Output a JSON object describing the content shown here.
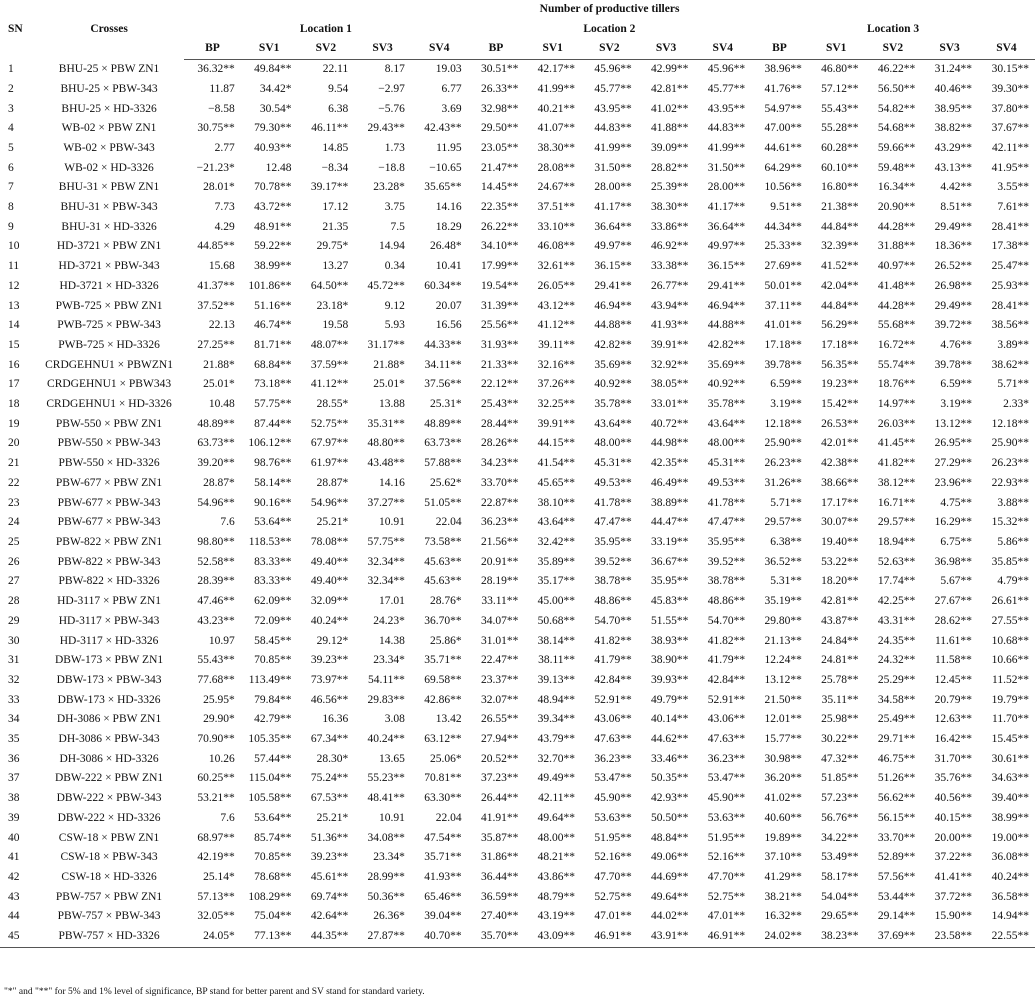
{
  "header": {
    "sn": "SN",
    "crosses": "Crosses",
    "main_title": "Number of productive tillers",
    "locations": [
      "Location 1",
      "Location 2",
      "Location 3"
    ],
    "subcols": [
      "BP",
      "SV1",
      "SV2",
      "SV3",
      "SV4"
    ]
  },
  "rows": [
    {
      "sn": "1",
      "cross": "BHU-25 × PBW ZN1",
      "v": [
        "36.32**",
        "49.84**",
        "22.11",
        "8.17",
        "19.03",
        "30.51**",
        "42.17**",
        "45.96**",
        "42.99**",
        "45.96**",
        "38.96**",
        "46.80**",
        "46.22**",
        "31.24**",
        "30.15**"
      ]
    },
    {
      "sn": "2",
      "cross": "BHU-25 × PBW-343",
      "v": [
        "11.87",
        "34.42*",
        "9.54",
        "−2.97",
        "6.77",
        "26.33**",
        "41.99**",
        "45.77**",
        "42.81**",
        "45.77**",
        "41.76**",
        "57.12**",
        "56.50**",
        "40.46**",
        "39.30**"
      ]
    },
    {
      "sn": "3",
      "cross": "BHU-25 × HD-3326",
      "v": [
        "−8.58",
        "30.54*",
        "6.38",
        "−5.76",
        "3.69",
        "32.98**",
        "40.21**",
        "43.95**",
        "41.02**",
        "43.95**",
        "54.97**",
        "55.43**",
        "54.82**",
        "38.95**",
        "37.80**"
      ]
    },
    {
      "sn": "4",
      "cross": "WB-02 × PBW ZN1",
      "v": [
        "30.75**",
        "79.30**",
        "46.11**",
        "29.43**",
        "42.43**",
        "29.50**",
        "41.07**",
        "44.83**",
        "41.88**",
        "44.83**",
        "47.00**",
        "55.28**",
        "54.68**",
        "38.82**",
        "37.67**"
      ]
    },
    {
      "sn": "5",
      "cross": "WB-02 × PBW-343",
      "v": [
        "2.77",
        "40.93**",
        "14.85",
        "1.73",
        "11.95",
        "23.05**",
        "38.30**",
        "41.99**",
        "39.09**",
        "41.99**",
        "44.61**",
        "60.28**",
        "59.66**",
        "43.29**",
        "42.11**"
      ]
    },
    {
      "sn": "6",
      "cross": "WB-02 × HD-3326",
      "v": [
        "−21.23*",
        "12.48",
        "−8.34",
        "−18.8",
        "−10.65",
        "21.47**",
        "28.08**",
        "31.50**",
        "28.82**",
        "31.50**",
        "64.29**",
        "60.10**",
        "59.48**",
        "43.13**",
        "41.95**"
      ]
    },
    {
      "sn": "7",
      "cross": "BHU-31 × PBW ZN1",
      "v": [
        "28.01*",
        "70.78**",
        "39.17**",
        "23.28*",
        "35.65**",
        "14.45**",
        "24.67**",
        "28.00**",
        "25.39**",
        "28.00**",
        "10.56**",
        "16.80**",
        "16.34**",
        "4.42**",
        "3.55**"
      ]
    },
    {
      "sn": "8",
      "cross": "BHU-31 × PBW-343",
      "v": [
        "7.73",
        "43.72**",
        "17.12",
        "3.75",
        "14.16",
        "22.35**",
        "37.51**",
        "41.17**",
        "38.30**",
        "41.17**",
        "9.51**",
        "21.38**",
        "20.90**",
        "8.51**",
        "7.61**"
      ]
    },
    {
      "sn": "9",
      "cross": "BHU-31 × HD-3326",
      "v": [
        "4.29",
        "48.91**",
        "21.35",
        "7.5",
        "18.29",
        "26.22**",
        "33.10**",
        "36.64**",
        "33.86**",
        "36.64**",
        "44.34**",
        "44.84**",
        "44.28**",
        "29.49**",
        "28.41**"
      ]
    },
    {
      "sn": "10",
      "cross": "HD-3721 × PBW ZN1",
      "v": [
        "44.85**",
        "59.22**",
        "29.75*",
        "14.94",
        "26.48*",
        "34.10**",
        "46.08**",
        "49.97**",
        "46.92**",
        "49.97**",
        "25.33**",
        "32.39**",
        "31.88**",
        "18.36**",
        "17.38**"
      ]
    },
    {
      "sn": "11",
      "cross": "HD-3721 × PBW-343",
      "v": [
        "15.68",
        "38.99**",
        "13.27",
        "0.34",
        "10.41",
        "17.99**",
        "32.61**",
        "36.15**",
        "33.38**",
        "36.15**",
        "27.69**",
        "41.52**",
        "40.97**",
        "26.52**",
        "25.47**"
      ]
    },
    {
      "sn": "12",
      "cross": "HD-3721 × HD-3326",
      "v": [
        "41.37**",
        "101.86**",
        "64.50**",
        "45.72**",
        "60.34**",
        "19.54**",
        "26.05**",
        "29.41**",
        "26.77**",
        "29.41**",
        "50.01**",
        "42.04**",
        "41.48**",
        "26.98**",
        "25.93**"
      ]
    },
    {
      "sn": "13",
      "cross": "PWB-725 × PBW ZN1",
      "v": [
        "37.52**",
        "51.16**",
        "23.18*",
        "9.12",
        "20.07",
        "31.39**",
        "43.12**",
        "46.94**",
        "43.94**",
        "46.94**",
        "37.11**",
        "44.84**",
        "44.28**",
        "29.49**",
        "28.41**"
      ]
    },
    {
      "sn": "14",
      "cross": "PWB-725 × PBW-343",
      "v": [
        "22.13",
        "46.74**",
        "19.58",
        "5.93",
        "16.56",
        "25.56**",
        "41.12**",
        "44.88**",
        "41.93**",
        "44.88**",
        "41.01**",
        "56.29**",
        "55.68**",
        "39.72**",
        "38.56**"
      ]
    },
    {
      "sn": "15",
      "cross": "PWB-725 × HD-3326",
      "v": [
        "27.25**",
        "81.71**",
        "48.07**",
        "31.17**",
        "44.33**",
        "31.93**",
        "39.11**",
        "42.82**",
        "39.91**",
        "42.82**",
        "17.18**",
        "17.18**",
        "16.72**",
        "4.76**",
        "3.89**"
      ]
    },
    {
      "sn": "16",
      "cross": "CRDGEHNU1 × PBWZN1",
      "v": [
        "21.88*",
        "68.84**",
        "37.59**",
        "21.88*",
        "34.11**",
        "21.33**",
        "32.16**",
        "35.69**",
        "32.92**",
        "35.69**",
        "39.78**",
        "56.35**",
        "55.74**",
        "39.78**",
        "38.62**"
      ]
    },
    {
      "sn": "17",
      "cross": "CRDGEHNU1 × PBW343",
      "v": [
        "25.01*",
        "73.18**",
        "41.12**",
        "25.01*",
        "37.56**",
        "22.12**",
        "37.26**",
        "40.92**",
        "38.05**",
        "40.92**",
        "6.59**",
        "19.23**",
        "18.76**",
        "6.59**",
        "5.71**"
      ]
    },
    {
      "sn": "18",
      "cross": "CRDGEHNU1 × HD-3326",
      "v": [
        "10.48",
        "57.75**",
        "28.55*",
        "13.88",
        "25.31*",
        "25.43**",
        "32.25**",
        "35.78**",
        "33.01**",
        "35.78**",
        "3.19**",
        "15.42**",
        "14.97**",
        "3.19**",
        "2.33*"
      ]
    },
    {
      "sn": "19",
      "cross": "PBW-550 × PBW ZN1",
      "v": [
        "48.89**",
        "87.44**",
        "52.75**",
        "35.31**",
        "48.89**",
        "28.44**",
        "39.91**",
        "43.64**",
        "40.72**",
        "43.64**",
        "12.18**",
        "26.53**",
        "26.03**",
        "13.12**",
        "12.18**"
      ]
    },
    {
      "sn": "20",
      "cross": "PBW-550 × PBW-343",
      "v": [
        "63.73**",
        "106.12**",
        "67.97**",
        "48.80**",
        "63.73**",
        "28.26**",
        "44.15**",
        "48.00**",
        "44.98**",
        "48.00**",
        "25.90**",
        "42.01**",
        "41.45**",
        "26.95**",
        "25.90**"
      ]
    },
    {
      "sn": "21",
      "cross": "PBW-550 × HD-3326",
      "v": [
        "39.20**",
        "98.76**",
        "61.97**",
        "43.48**",
        "57.88**",
        "34.23**",
        "41.54**",
        "45.31**",
        "42.35**",
        "45.31**",
        "26.23**",
        "42.38**",
        "41.82**",
        "27.29**",
        "26.23**"
      ]
    },
    {
      "sn": "22",
      "cross": "PBW-677 × PBW ZN1",
      "v": [
        "28.87*",
        "58.14**",
        "28.87*",
        "14.16",
        "25.62*",
        "33.70**",
        "45.65**",
        "49.53**",
        "46.49**",
        "49.53**",
        "31.26**",
        "38.66**",
        "38.12**",
        "23.96**",
        "22.93**"
      ]
    },
    {
      "sn": "23",
      "cross": "PBW-677 × PBW-343",
      "v": [
        "54.96**",
        "90.16**",
        "54.96**",
        "37.27**",
        "51.05**",
        "22.87**",
        "38.10**",
        "41.78**",
        "38.89**",
        "41.78**",
        "5.71**",
        "17.17**",
        "16.71**",
        "4.75**",
        "3.88**"
      ]
    },
    {
      "sn": "24",
      "cross": "PBW-677 × PBW-343",
      "v": [
        "7.6",
        "53.64**",
        "25.21*",
        "10.91",
        "22.04",
        "36.23**",
        "43.64**",
        "47.47**",
        "44.47**",
        "47.47**",
        "29.57**",
        "30.07**",
        "29.57**",
        "16.29**",
        "15.32**"
      ]
    },
    {
      "sn": "25",
      "cross": "PBW-822 × PBW ZN1",
      "v": [
        "98.80**",
        "118.53**",
        "78.08**",
        "57.75**",
        "73.58**",
        "21.56**",
        "32.42**",
        "35.95**",
        "33.19**",
        "35.95**",
        "6.38**",
        "19.40**",
        "18.94**",
        "6.75**",
        "5.86**"
      ]
    },
    {
      "sn": "26",
      "cross": "PBW-822 × PBW-343",
      "v": [
        "52.58**",
        "83.33**",
        "49.40**",
        "32.34**",
        "45.63**",
        "20.91**",
        "35.89**",
        "39.52**",
        "36.67**",
        "39.52**",
        "36.52**",
        "53.22**",
        "52.63**",
        "36.98**",
        "35.85**"
      ]
    },
    {
      "sn": "27",
      "cross": "PBW-822 × HD-3326",
      "v": [
        "28.39**",
        "83.33**",
        "49.40**",
        "32.34**",
        "45.63**",
        "28.19**",
        "35.17**",
        "38.78**",
        "35.95**",
        "38.78**",
        "5.31**",
        "18.20**",
        "17.74**",
        "5.67**",
        "4.79**"
      ]
    },
    {
      "sn": "28",
      "cross": "HD-3117 × PBW ZN1",
      "v": [
        "47.46**",
        "62.09**",
        "32.09**",
        "17.01",
        "28.76*",
        "33.11**",
        "45.00**",
        "48.86**",
        "45.83**",
        "48.86**",
        "35.19**",
        "42.81**",
        "42.25**",
        "27.67**",
        "26.61**"
      ]
    },
    {
      "sn": "29",
      "cross": "HD-3117 × PBW-343",
      "v": [
        "43.23**",
        "72.09**",
        "40.24**",
        "24.23*",
        "36.70**",
        "34.07**",
        "50.68**",
        "54.70**",
        "51.55**",
        "54.70**",
        "29.80**",
        "43.87**",
        "43.31**",
        "28.62**",
        "27.55**"
      ]
    },
    {
      "sn": "30",
      "cross": "HD-3117 × HD-3326",
      "v": [
        "10.97",
        "58.45**",
        "29.12*",
        "14.38",
        "25.86*",
        "31.01**",
        "38.14**",
        "41.82**",
        "38.93**",
        "41.82**",
        "21.13**",
        "24.84**",
        "24.35**",
        "11.61**",
        "10.68**"
      ]
    },
    {
      "sn": "31",
      "cross": "DBW-173 × PBW ZN1",
      "v": [
        "55.43**",
        "70.85**",
        "39.23**",
        "23.34*",
        "35.71**",
        "22.47**",
        "38.11**",
        "41.79**",
        "38.90**",
        "41.79**",
        "12.24**",
        "24.81**",
        "24.32**",
        "11.58**",
        "10.66**"
      ]
    },
    {
      "sn": "32",
      "cross": "DBW-173 × PBW-343",
      "v": [
        "77.68**",
        "113.49**",
        "73.97**",
        "54.11**",
        "69.58**",
        "23.37**",
        "39.13**",
        "42.84**",
        "39.93**",
        "42.84**",
        "13.12**",
        "25.78**",
        "25.29**",
        "12.45**",
        "11.52**"
      ]
    },
    {
      "sn": "33",
      "cross": "DBW-173 × HD-3326",
      "v": [
        "25.95*",
        "79.84**",
        "46.56**",
        "29.83**",
        "42.86**",
        "32.07**",
        "48.94**",
        "52.91**",
        "49.79**",
        "52.91**",
        "21.50**",
        "35.11**",
        "34.58**",
        "20.79**",
        "19.79**"
      ]
    },
    {
      "sn": "34",
      "cross": "DH-3086 × PBW ZN1",
      "v": [
        "29.90*",
        "42.79**",
        "16.36",
        "3.08",
        "13.42",
        "26.55**",
        "39.34**",
        "43.06**",
        "40.14**",
        "43.06**",
        "12.01**",
        "25.98**",
        "25.49**",
        "12.63**",
        "11.70**"
      ]
    },
    {
      "sn": "35",
      "cross": "DH-3086 × PBW-343",
      "v": [
        "70.90**",
        "105.35**",
        "67.34**",
        "40.24**",
        "63.12**",
        "27.94**",
        "43.79**",
        "47.63**",
        "44.62**",
        "47.63**",
        "15.77**",
        "30.22**",
        "29.71**",
        "16.42**",
        "15.45**"
      ]
    },
    {
      "sn": "36",
      "cross": "DH-3086 × HD-3326",
      "v": [
        "10.26",
        "57.44**",
        "28.30*",
        "13.65",
        "25.06*",
        "20.52**",
        "32.70**",
        "36.23**",
        "33.46**",
        "36.23**",
        "30.98**",
        "47.32**",
        "46.75**",
        "31.70**",
        "30.61**"
      ]
    },
    {
      "sn": "37",
      "cross": "DBW-222 × PBW ZN1",
      "v": [
        "60.25**",
        "115.04**",
        "75.24**",
        "55.23**",
        "70.81**",
        "37.23**",
        "49.49**",
        "53.47**",
        "50.35**",
        "53.47**",
        "36.20**",
        "51.85**",
        "51.26**",
        "35.76**",
        "34.63**"
      ]
    },
    {
      "sn": "38",
      "cross": "DBW-222 × PBW-343",
      "v": [
        "53.21**",
        "105.58**",
        "67.53**",
        "48.41**",
        "63.30**",
        "26.44**",
        "42.11**",
        "45.90**",
        "42.93**",
        "45.90**",
        "41.02**",
        "57.23**",
        "56.62**",
        "40.56**",
        "39.40**"
      ]
    },
    {
      "sn": "39",
      "cross": "DBW-222 × HD-3326",
      "v": [
        "7.6",
        "53.64**",
        "25.21*",
        "10.91",
        "22.04",
        "41.91**",
        "49.64**",
        "53.63**",
        "50.50**",
        "53.63**",
        "40.60**",
        "56.76**",
        "56.15**",
        "40.15**",
        "38.99**"
      ]
    },
    {
      "sn": "40",
      "cross": "CSW-18 × PBW ZN1",
      "v": [
        "68.97**",
        "85.74**",
        "51.36**",
        "34.08**",
        "47.54**",
        "35.87**",
        "48.00**",
        "51.95**",
        "48.84**",
        "51.95**",
        "19.89**",
        "34.22**",
        "33.70**",
        "20.00**",
        "19.00**"
      ]
    },
    {
      "sn": "41",
      "cross": "CSW-18 × PBW-343",
      "v": [
        "42.19**",
        "70.85**",
        "39.23**",
        "23.34*",
        "35.71**",
        "31.86**",
        "48.21**",
        "52.16**",
        "49.06**",
        "52.16**",
        "37.10**",
        "53.49**",
        "52.89**",
        "37.22**",
        "36.08**"
      ]
    },
    {
      "sn": "42",
      "cross": "CSW-18 × HD-3326",
      "v": [
        "25.14*",
        "78.68**",
        "45.61**",
        "28.99**",
        "41.93**",
        "36.44**",
        "43.86**",
        "47.70**",
        "44.69**",
        "47.70**",
        "41.29**",
        "58.17**",
        "57.56**",
        "41.41**",
        "40.24**"
      ]
    },
    {
      "sn": "43",
      "cross": "PBW-757 × PBW ZN1",
      "v": [
        "57.13**",
        "108.29**",
        "69.74**",
        "50.36**",
        "65.46**",
        "36.59**",
        "48.79**",
        "52.75**",
        "49.64**",
        "52.75**",
        "38.21**",
        "54.04**",
        "53.44**",
        "37.72**",
        "36.58**"
      ]
    },
    {
      "sn": "44",
      "cross": "PBW-757 × PBW-343",
      "v": [
        "32.05**",
        "75.04**",
        "42.64**",
        "26.36*",
        "39.04**",
        "27.40**",
        "43.19**",
        "47.01**",
        "44.02**",
        "47.01**",
        "16.32**",
        "29.65**",
        "29.14**",
        "15.90**",
        "14.94**"
      ]
    },
    {
      "sn": "45",
      "cross": "PBW-757 × HD-3326",
      "v": [
        "24.05*",
        "77.13**",
        "44.35**",
        "27.87**",
        "40.70**",
        "35.70**",
        "43.09**",
        "46.91**",
        "43.91**",
        "46.91**",
        "24.02**",
        "38.23**",
        "37.69**",
        "23.58**",
        "22.55**"
      ]
    }
  ],
  "footnote": "\"*\" and \"**\" for 5% and 1% level of significance, BP stand for better parent and SV stand for standard variety."
}
